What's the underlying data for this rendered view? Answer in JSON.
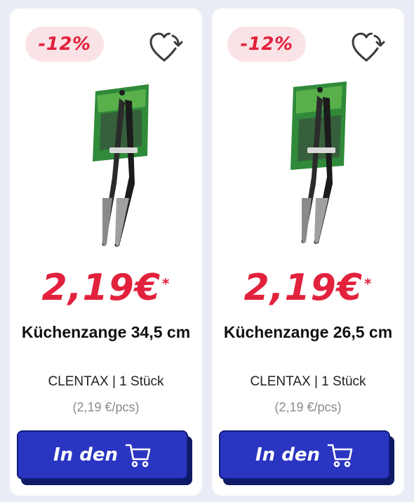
{
  "products": [
    {
      "discount": "-12%",
      "price_main": "2,19€",
      "price_marker": "*",
      "name": "Küchenzange 34,5 cm",
      "brand_qty": "CLENTAX | 1 Stück",
      "unit_price": "(2,19 €/pcs)",
      "button_label": "In den",
      "wishlist_icon": "heart-refresh-icon",
      "cart_icon": "cart-icon"
    },
    {
      "discount": "-12%",
      "price_main": "2,19€",
      "price_marker": "*",
      "name": "Küchenzange 26,5 cm",
      "brand_qty": "CLENTAX | 1 Stück",
      "unit_price": "(2,19 €/pcs)",
      "button_label": "In den",
      "wishlist_icon": "heart-refresh-icon",
      "cart_icon": "cart-icon"
    }
  ],
  "colors": {
    "background": "#e9ecf4",
    "card": "#ffffff",
    "accent_red": "#e2213c",
    "badge_bg": "#fae3e6",
    "button_blue": "#2a35c2",
    "button_shadow": "#0e1a66",
    "muted_text": "#8b8b8b"
  }
}
